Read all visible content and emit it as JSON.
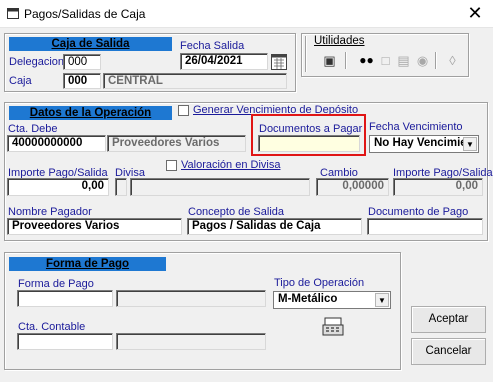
{
  "window": {
    "title": "Pagos/Salidas de Caja"
  },
  "caja_salida": {
    "header": "Caja de Salida",
    "fecha_label": "Fecha Salida",
    "fecha_value": "26/04/2021",
    "delegacion_label": "Delegacion",
    "delegacion_value": "000",
    "caja_label": "Caja",
    "caja_value": "000",
    "caja_name": "CENTRAL"
  },
  "utilidades": {
    "label": "Utilidades"
  },
  "datos": {
    "header": "Datos de la Operación",
    "generar_label": "Generar Vencimiento de Depósito",
    "cta_debe_label": "Cta. Debe",
    "cta_debe_value": "40000000000",
    "cta_debe_name": "Proveedores Varios",
    "documentos_label": "Documentos a Pagar",
    "documentos_value": "",
    "fecha_venc_label": "Fecha Vencimiento",
    "fecha_venc_value": "No Hay Vencimier",
    "valoracion_label": "Valoración en Divisa",
    "importe_label": "Importe Pago/Salida",
    "importe_value": "0,00",
    "divisa_label": "Divisa",
    "cambio_label": "Cambio",
    "cambio_value": "0,00000",
    "importe2_label": "Importe Pago/Salida",
    "importe2_value": "0,00",
    "pagador_label": "Nombre Pagador",
    "pagador_value": "Proveedores Varios",
    "concepto_label": "Concepto de Salida",
    "concepto_value": "Pagos / Salidas de Caja",
    "documento_pago_label": "Documento de Pago",
    "documento_pago_value": ""
  },
  "forma_pago": {
    "header": "Forma de Pago",
    "forma_label": "Forma de Pago",
    "tipo_label": "Tipo de Operación",
    "tipo_value": "M-Metálico",
    "cta_contable_label": "Cta. Contable"
  },
  "buttons": {
    "aceptar": "Aceptar",
    "cancelar": "Cancelar"
  },
  "colors": {
    "section_header": "#1e78d2",
    "highlight": "#e01515"
  }
}
